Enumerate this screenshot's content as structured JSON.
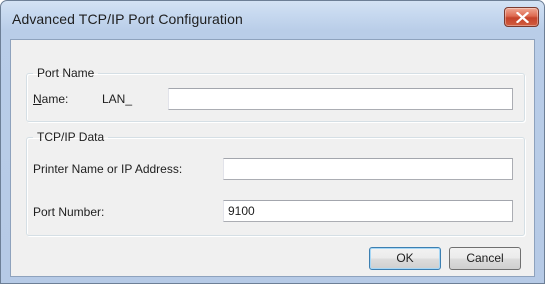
{
  "window": {
    "title": "Advanced TCP/IP Port Configuration",
    "close_icon": "close-icon"
  },
  "port_name_group": {
    "legend": "Port Name",
    "name_label_mnemonic": "N",
    "name_label_rest": "ame:",
    "name_prefix": "LAN_",
    "name_value": ""
  },
  "tcpip_group": {
    "legend": "TCP/IP Data",
    "printer_label": "Printer Name or IP Address:",
    "printer_value": "",
    "port_number_label": "Port Number:",
    "port_number_value": "9100"
  },
  "buttons": {
    "ok": "OK",
    "cancel": "Cancel"
  }
}
